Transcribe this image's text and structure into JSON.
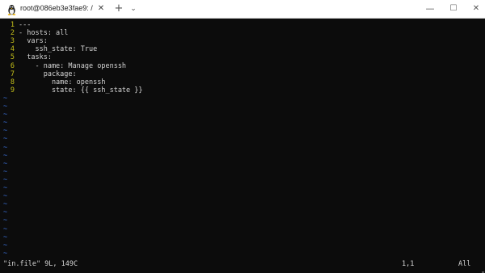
{
  "window": {
    "tab_title": "root@086eb3e3fae9: /",
    "tab_icon": "linux-penguin-icon",
    "close_tab_glyph": "✕",
    "new_tab_glyph": "+",
    "dropdown_glyph": "⌄",
    "minimize_glyph": "—",
    "maximize_glyph": "☐",
    "close_glyph": "✕"
  },
  "editor": {
    "lines": [
      {
        "num": "1",
        "text": "---"
      },
      {
        "num": "2",
        "text": "- hosts: all"
      },
      {
        "num": "3",
        "text": "  vars:"
      },
      {
        "num": "4",
        "text": "    ssh_state: True"
      },
      {
        "num": "5",
        "text": "  tasks:"
      },
      {
        "num": "6",
        "text": "    - name: Manage openssh"
      },
      {
        "num": "7",
        "text": "      package:"
      },
      {
        "num": "8",
        "text": "        name: openssh"
      },
      {
        "num": "9",
        "text": "        state: {{ ssh_state }}"
      }
    ],
    "empty_line_marker": "~"
  },
  "statusbar": {
    "file_info": "\"in.file\" 9L, 149C",
    "cursor_position": "1,1",
    "scroll_position": "All"
  },
  "colors": {
    "line_number": "#c5c01a",
    "tilde": "#3a6fd8",
    "text": "#d4d4d4",
    "background": "#0c0c0c"
  }
}
